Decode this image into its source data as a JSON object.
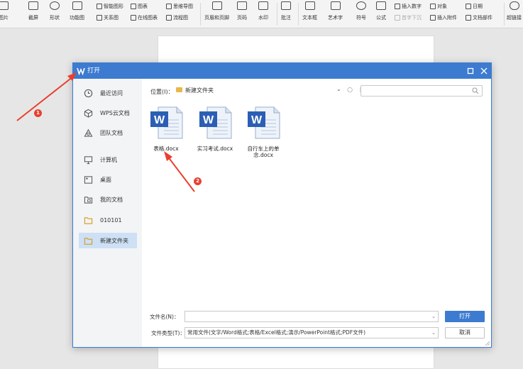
{
  "ribbon": {
    "big": [
      {
        "label": "图片",
        "icon": "picture-icon"
      },
      {
        "label": "截屏",
        "icon": "screenshot-icon"
      },
      {
        "label": "形状",
        "icon": "shapes-icon"
      },
      {
        "label": "功能图",
        "icon": "function-chart-icon"
      },
      {
        "label": "页眉和页脚",
        "icon": "header-footer-icon"
      },
      {
        "label": "页码",
        "icon": "page-number-icon"
      },
      {
        "label": "水印",
        "icon": "watermark-icon"
      },
      {
        "label": "批注",
        "icon": "comment-icon"
      },
      {
        "label": "文本框",
        "icon": "textbox-icon"
      },
      {
        "label": "艺术字",
        "icon": "wordart-icon"
      },
      {
        "label": "符号",
        "icon": "symbol-icon"
      },
      {
        "label": "公式",
        "icon": "formula-icon"
      },
      {
        "label": "超链接",
        "icon": "hyperlink-icon"
      }
    ],
    "small": [
      {
        "label": "智能图形",
        "icon": "smartart-icon"
      },
      {
        "label": "关系图",
        "icon": "relation-chart-icon"
      },
      {
        "label": "图表",
        "icon": "chart-icon"
      },
      {
        "label": "在线图表",
        "icon": "online-chart-icon"
      },
      {
        "label": "思维导图",
        "icon": "mindmap-icon"
      },
      {
        "label": "流程图",
        "icon": "flowchart-icon"
      },
      {
        "label": "插入数字",
        "icon": "insert-number-icon"
      },
      {
        "label": "首字下沉",
        "icon": "dropcap-icon"
      },
      {
        "label": "对象",
        "icon": "object-icon"
      },
      {
        "label": "插入附件",
        "icon": "attachment-icon"
      },
      {
        "label": "日期",
        "icon": "date-icon"
      },
      {
        "label": "文档部件",
        "icon": "doc-parts-icon"
      }
    ]
  },
  "dialog": {
    "title": "打开",
    "sidebar": [
      {
        "label": "最近访问",
        "icon": "clock-icon"
      },
      {
        "label": "WPS云文档",
        "icon": "cloud-cube-icon"
      },
      {
        "label": "团队文档",
        "icon": "team-icon"
      },
      {
        "label": "计算机",
        "icon": "computer-icon"
      },
      {
        "label": "桌面",
        "icon": "desktop-icon"
      },
      {
        "label": "我的文档",
        "icon": "my-documents-icon"
      },
      {
        "label": "010101",
        "icon": "folder-icon"
      },
      {
        "label": "新建文件夹",
        "icon": "folder-icon"
      }
    ],
    "location_label": "位置(I)：",
    "location_value": "新建文件夹",
    "files": [
      {
        "name": "表格.docx"
      },
      {
        "name": "实习考试.docx"
      },
      {
        "name": "自行车上的单念.docx"
      }
    ],
    "filename_label": "文件名(N)：",
    "filename_value": "",
    "filetype_label": "文件类型(T)：",
    "filetype_value": "常用文件(文字/Word格式;表格/Excel格式;演示/PowerPoint格式;PDF文件)",
    "open_button": "打开",
    "cancel_button": "取消"
  },
  "annotations": [
    {
      "number": "1"
    },
    {
      "number": "2"
    }
  ],
  "colors": {
    "accent": "#3c7bd0",
    "sidebar_active": "#cde0f5",
    "annotation": "#e8402f",
    "folder": "#e8b84a",
    "word_blue": "#2b5fb4"
  }
}
